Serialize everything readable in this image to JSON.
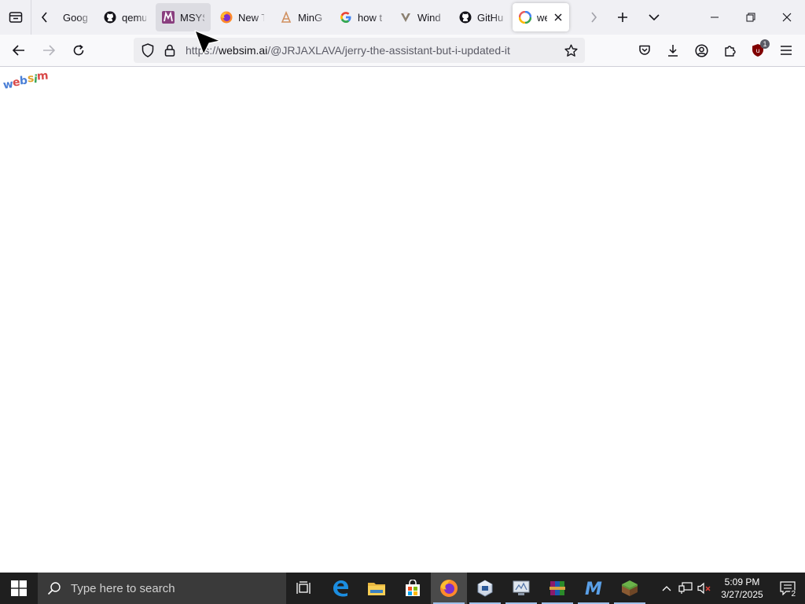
{
  "browser": {
    "tabs": [
      {
        "title": "Googl",
        "icon": "google-drive-icon",
        "state": "normal"
      },
      {
        "title": "qemu",
        "icon": "github-icon",
        "state": "normal"
      },
      {
        "title": "MSYS",
        "icon": "msys2-icon",
        "state": "hover"
      },
      {
        "title": "New T",
        "icon": "firefox-icon",
        "state": "normal"
      },
      {
        "title": "MinG",
        "icon": "sourceforge-icon",
        "state": "normal"
      },
      {
        "title": "how t",
        "icon": "google-icon",
        "state": "normal"
      },
      {
        "title": "Wind",
        "icon": "vivaldi-icon",
        "state": "normal"
      },
      {
        "title": "GitHu",
        "icon": "github-icon",
        "state": "normal"
      },
      {
        "title": "we",
        "icon": "websim-icon",
        "state": "selected"
      }
    ],
    "url": {
      "scheme": "https://",
      "host": "websim.ai",
      "path": "/@JRJAXLAVA/jerry-the-assistant-but-i-updated-it"
    },
    "extension_badge": "1"
  },
  "page": {
    "logo_letters": [
      "w",
      "e",
      "b",
      "s",
      "i",
      "m"
    ],
    "logo_colors": [
      "#4a7fd6",
      "#d94a4a",
      "#4a7fd6",
      "#e2a32b",
      "#3aa55a",
      "#d94a4a"
    ]
  },
  "taskbar": {
    "search_placeholder": "Type here to search",
    "time": "5:09 PM",
    "date": "3/27/2025",
    "notification_count": "2"
  }
}
